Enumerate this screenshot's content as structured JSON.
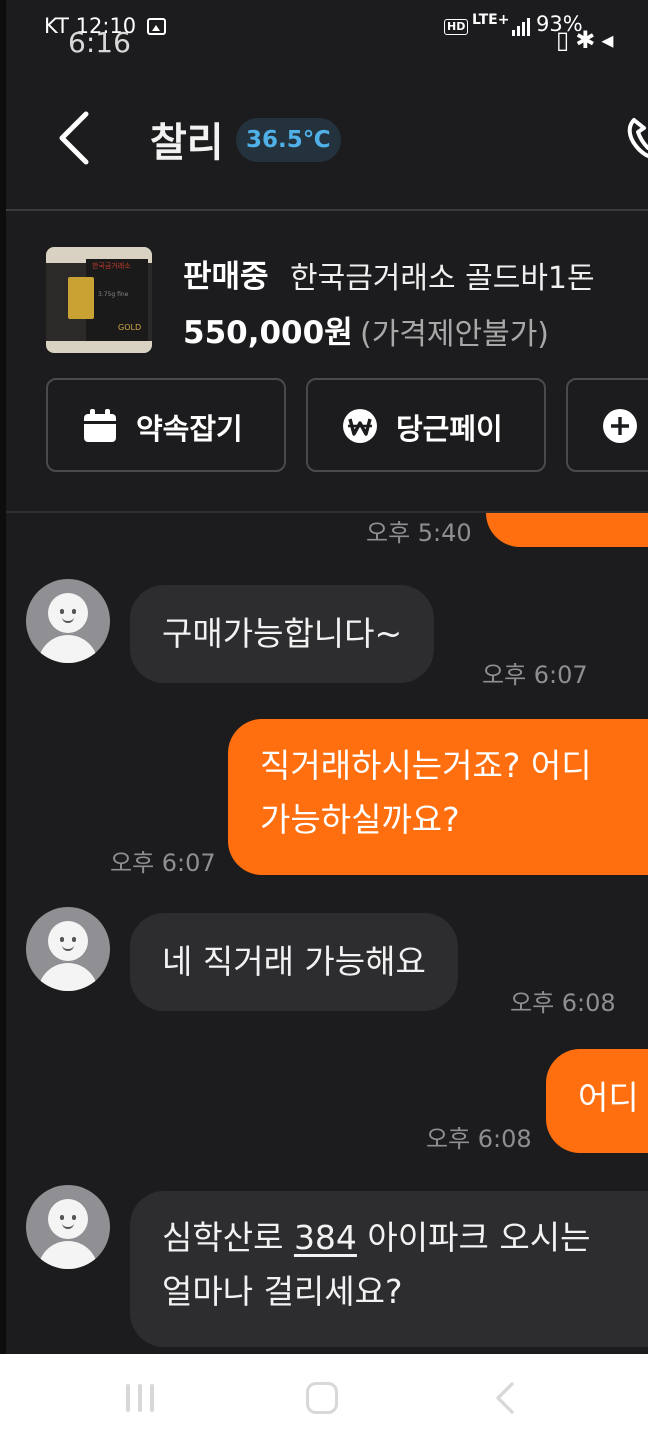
{
  "status_bar": {
    "carrier_time": "KT 12:10",
    "overlay_time": "6:16",
    "hd": "HD",
    "network": "LTE+",
    "battery": "93%"
  },
  "header": {
    "name": "찰리",
    "temperature": "36.5℃"
  },
  "product": {
    "status": "판매중",
    "title": "한국금거래소 골드바1돈",
    "price": "550,000원",
    "negotiation": "(가격제안불가)",
    "thumb_brand": "한국금거래소",
    "thumb_gold": "GOLD",
    "thumb_fine": "3.75g fine"
  },
  "actions": {
    "schedule": "약속잡기",
    "pay": "당근페이"
  },
  "messages": [
    {
      "side": "out",
      "text": "",
      "time": "오후 5:40"
    },
    {
      "side": "in",
      "text": "구매가능합니다~",
      "time": "오후 6:07"
    },
    {
      "side": "out",
      "line1": "직거래하시는거죠? 어디",
      "line2": "가능하실까요?",
      "time": "오후 6:07"
    },
    {
      "side": "in",
      "text": "네 직거래 가능해요",
      "time": "오후 6:08"
    },
    {
      "side": "out",
      "text": "어디",
      "time": "오후 6:08"
    },
    {
      "side": "in",
      "line1_a": "심학산로 ",
      "line1_b": "384",
      "line1_c": " 아이파크 오시는",
      "line2": "얼마나 걸리세요?"
    }
  ],
  "colors": {
    "background": "#1c1c1e",
    "incoming_bubble": "#2d2d30",
    "outgoing_bubble": "#ff6f0f",
    "temperature": "#4fb1e8"
  }
}
